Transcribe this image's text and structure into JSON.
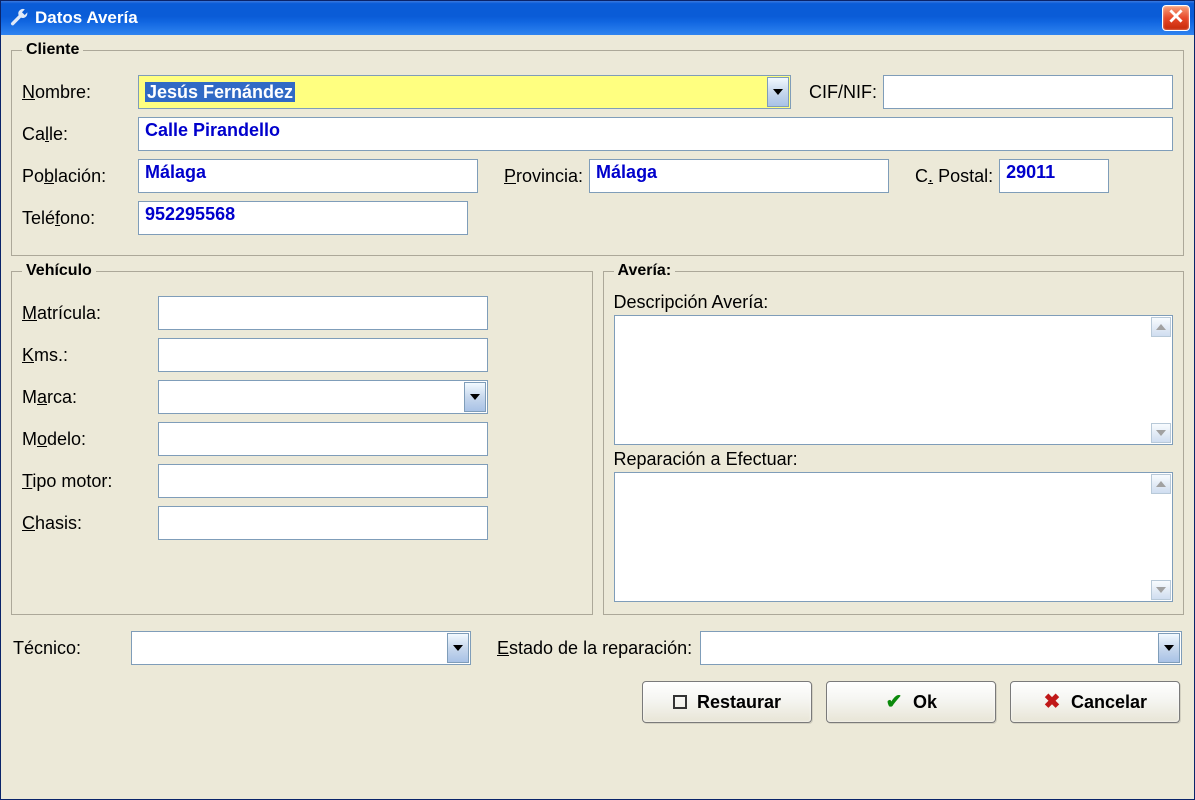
{
  "title": "Datos Avería",
  "cliente": {
    "legend": "Cliente",
    "nombre_label": "Nombre:",
    "nombre_value": "Jesús Fernández",
    "cif_label": "CIF/NIF:",
    "cif_value": "",
    "calle_label": "Calle:",
    "calle_value": "Calle Pirandello",
    "poblacion_label": "Población:",
    "poblacion_value": "Málaga",
    "provincia_label": "Provincia:",
    "provincia_value": "Málaga",
    "cp_label": "C. Postal:",
    "cp_value": "29011",
    "telefono_label": "Teléfono:",
    "telefono_value": "952295568"
  },
  "vehiculo": {
    "legend": "Vehículo",
    "matricula_label": "Matrícula:",
    "matricula_value": "",
    "kms_label": "Kms.:",
    "kms_value": "",
    "marca_label": "Marca:",
    "marca_value": "",
    "modelo_label": "Modelo:",
    "modelo_value": "",
    "tipo_motor_label": "Tipo motor:",
    "tipo_motor_value": "",
    "chasis_label": "Chasis:",
    "chasis_value": ""
  },
  "averia": {
    "legend": "Avería:",
    "descripcion_label": "Descripción Avería:",
    "descripcion_value": "",
    "reparacion_label": "Reparación a Efectuar:",
    "reparacion_value": ""
  },
  "footer": {
    "tecnico_label": "Técnico:",
    "tecnico_value": "",
    "estado_label": "Estado de la reparación:",
    "estado_value": "",
    "restaurar": "Restaurar",
    "ok": "Ok",
    "cancelar": "Cancelar"
  }
}
